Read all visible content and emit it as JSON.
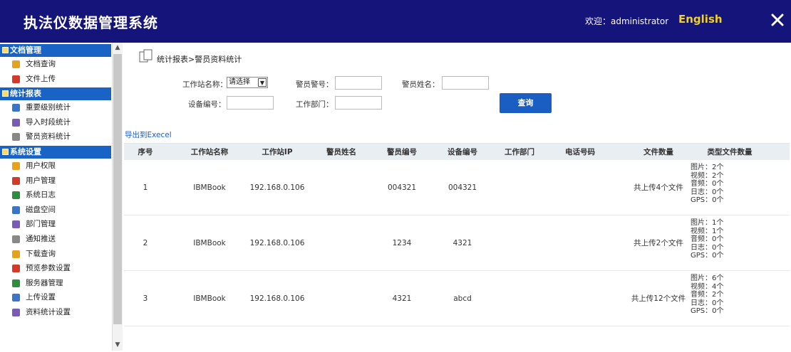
{
  "header": {
    "title": "执法仪数据管理系统",
    "welcome": "欢迎：administrator",
    "language_link": "English",
    "close_icon": "close-icon"
  },
  "sidebar": {
    "groups": [
      {
        "label": "文档管理",
        "icon": "document-icon",
        "items": [
          {
            "label": "文档查询",
            "icon": "search-doc-icon"
          },
          {
            "label": "文件上传",
            "icon": "upload-icon"
          }
        ]
      },
      {
        "label": "统计报表",
        "icon": "report-icon",
        "items": [
          {
            "label": "重要级别统计",
            "icon": "star-icon"
          },
          {
            "label": "导入时段统计",
            "icon": "import-icon"
          },
          {
            "label": "警员资料统计",
            "icon": "user-icon"
          }
        ]
      },
      {
        "label": "系统设置",
        "icon": "gear-icon",
        "items": [
          {
            "label": "用户权限",
            "icon": "key-icon"
          },
          {
            "label": "用户管理",
            "icon": "users-icon"
          },
          {
            "label": "系统日志",
            "icon": "log-icon"
          },
          {
            "label": "磁盘空间",
            "icon": "disk-icon"
          },
          {
            "label": "部门管理",
            "icon": "department-icon"
          },
          {
            "label": "通知推送",
            "icon": "notify-icon"
          },
          {
            "label": "下载查询",
            "icon": "download-icon"
          },
          {
            "label": "预览参数设置",
            "icon": "preview-icon"
          },
          {
            "label": "服务器管理",
            "icon": "server-icon"
          },
          {
            "label": "上传设置",
            "icon": "upload-settings-icon"
          },
          {
            "label": "资料统计设置",
            "icon": "stats-settings-icon"
          }
        ]
      }
    ]
  },
  "main": {
    "breadcrumb": "统计报表>警员资料统计",
    "filters": {
      "station_label": "工作站名称：",
      "station_value": "请选择",
      "officer_no_label": "警员警号：",
      "officer_name_label": "警员姓名：",
      "device_no_label": "设备编号：",
      "dept_label": "工作部门：",
      "query_button": "查询"
    },
    "export_link": "导出到Execel",
    "table": {
      "columns": [
        "序号",
        "工作站名称",
        "工作站IP",
        "警员姓名",
        "警员编号",
        "设备编号",
        "工作部门",
        "电话号码",
        "文件数量",
        "类型文件数量"
      ],
      "rows": [
        {
          "index": "1",
          "station": "IBMBook",
          "ip": "192.168.0.106",
          "name": "",
          "officer_no": "004321",
          "device_no": "004321",
          "dept": "",
          "phone": "",
          "file_count": "共上传4个文件",
          "types": [
            "图片：2个",
            "视频：2个",
            "音频：0个",
            "日志：0个",
            "GPS：0个"
          ]
        },
        {
          "index": "2",
          "station": "IBMBook",
          "ip": "192.168.0.106",
          "name": "",
          "officer_no": "1234",
          "device_no": "4321",
          "dept": "",
          "phone": "",
          "file_count": "共上传2个文件",
          "types": [
            "图片：1个",
            "视频：1个",
            "音频：0个",
            "日志：0个",
            "GPS：0个"
          ]
        },
        {
          "index": "3",
          "station": "IBMBook",
          "ip": "192.168.0.106",
          "name": "",
          "officer_no": "4321",
          "device_no": "abcd",
          "dept": "",
          "phone": "",
          "file_count": "共上传12个文件",
          "types": [
            "图片：6个",
            "视频：4个",
            "音频：2个",
            "日志：0个",
            "GPS：0个"
          ]
        }
      ]
    }
  },
  "colors": {
    "header_bg": "#15147a",
    "group_bg": "#1a63c6",
    "accent": "#1a5ec4",
    "language_link": "#f3d21a"
  }
}
